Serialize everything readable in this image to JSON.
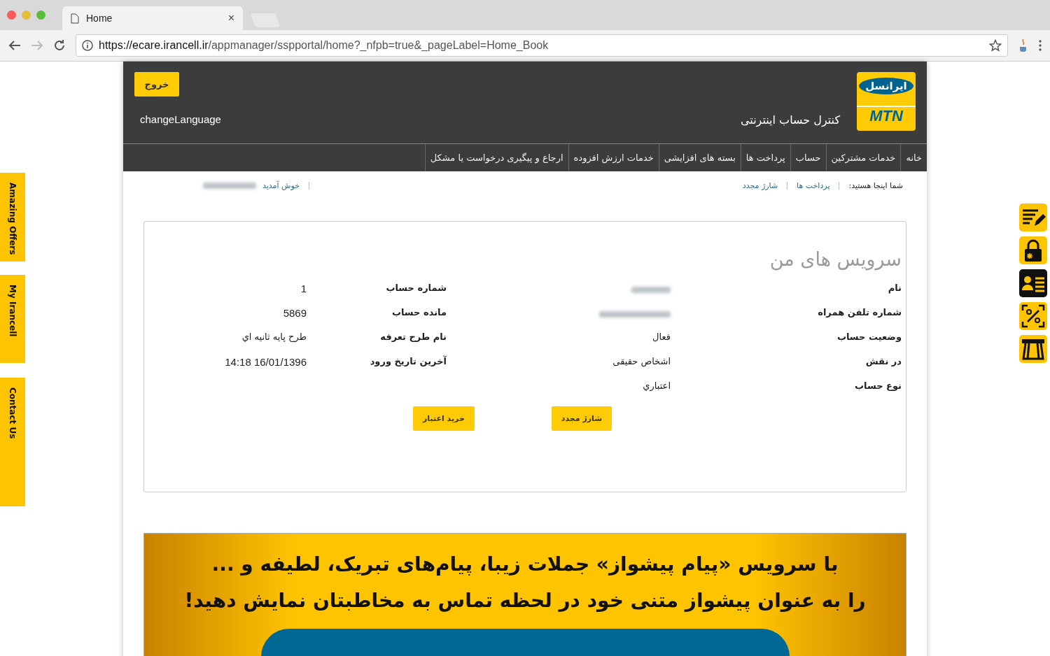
{
  "browser": {
    "tab_title": "Home",
    "tab_close": "×",
    "url_host": "https://ecare.irancell.ir",
    "url_path": "/appmanager/sspportal/home?_nfpb=true&_pageLabel=Home_Book"
  },
  "header": {
    "logout": "خروج",
    "change_language": "changeLanguage",
    "logo_top": "ایرانسل",
    "logo_bottom": "MTN",
    "subtitle": "کنترل حساب اینترنتی"
  },
  "nav": {
    "items": [
      "خانه",
      "خدمات مشترکین",
      "حساب",
      "پرداخت ها",
      "بسته های افزایشی",
      "خدمات ارزش افزوده",
      "ارجاع و پیگیری درخواست یا مشکل"
    ]
  },
  "breadcrumb": {
    "label": "شما اینجا هستید:",
    "links": [
      "پرداخت ها",
      "شارژ مجدد"
    ],
    "welcome": "خوش آمدید"
  },
  "services": {
    "title": "سرویس های من",
    "fields": [
      {
        "label": "نام",
        "kind": "hidden"
      },
      {
        "label": "شماره حساب",
        "value": "1",
        "kind": "text"
      },
      {
        "label": "شماره تلفن همراه",
        "kind": "hidden"
      },
      {
        "label": "مانده حساب",
        "value": "5869",
        "kind": "text"
      },
      {
        "label": "وضعیت حساب",
        "value": "فعال",
        "kind": "text"
      },
      {
        "label": "نام طرح تعرفه",
        "value": "طرح پایه ثانیه اي",
        "kind": "text"
      },
      {
        "label": "در نقش",
        "value": "اشخاص حقیقی",
        "kind": "text"
      },
      {
        "label": "آخرین تاریخ ورود",
        "value": "14:18 16/01/1396",
        "kind": "text"
      },
      {
        "label": "نوع حساب",
        "value": "اعتباري",
        "kind": "text"
      }
    ],
    "buttons": [
      "شارژ مجدد",
      "خرید اعتبار"
    ]
  },
  "banner": {
    "lines": [
      "با سرویس «پیام پیشواز» جملات زیبا، پیام‌های تبریک، لطیفه و ...",
      "را به عنوان پیشواز متنی خود در لحظه تماس به مخاطبتان نمایش دهید!"
    ]
  },
  "side_tabs": [
    "Amazing Offers",
    "My Irancell",
    "Contact Us"
  ]
}
